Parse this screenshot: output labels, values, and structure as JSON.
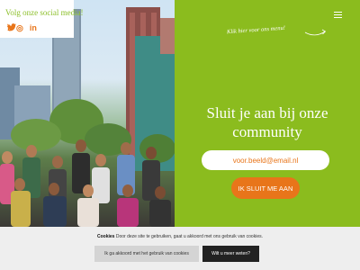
{
  "social": {
    "title": "Volg onze social media!",
    "icons": [
      {
        "name": "facebook-icon",
        "glyph": "f"
      },
      {
        "name": "instagram-icon",
        "glyph": "◎"
      },
      {
        "name": "linkedin-icon",
        "glyph": "in"
      },
      {
        "name": "twitter-icon",
        "glyph": "🐦"
      }
    ]
  },
  "colors": {
    "green": "#8bbc1e",
    "orange": "#e8751a",
    "social_text": "#8cbf2a"
  },
  "header": {
    "menu_hint": "Klik hier voor ons menu!"
  },
  "main": {
    "headline": "Sluit je aan bij onze community",
    "email_placeholder": "voor.beeld@email.nl",
    "join_label": "IK SLUIT ME AAN"
  },
  "cookie": {
    "label": "Cookies",
    "text": "Door deze site te gebruiken, gaat u akkoord met ons gebruik van cookies.",
    "accept_label": "Ik ga akkoord met het gebruik van cookies",
    "more_label": "Wilt u meer weten?"
  }
}
